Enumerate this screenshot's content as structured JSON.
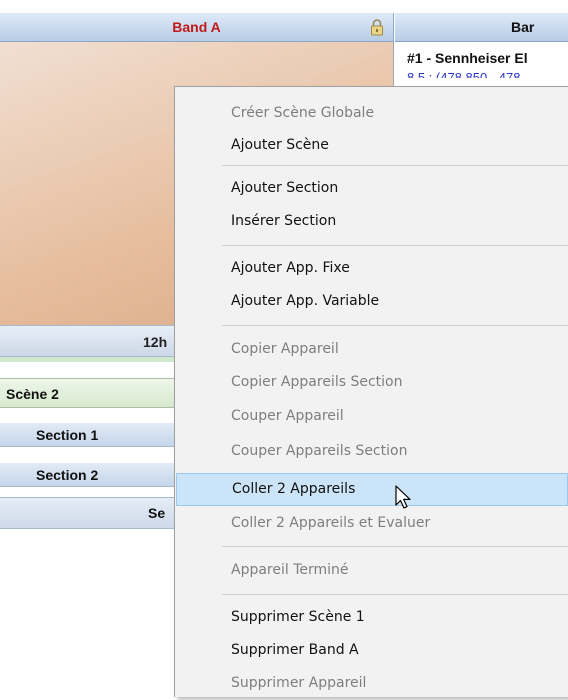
{
  "header": {
    "band_a": "Band A",
    "band_b": "Bar",
    "lock_icon": "lock-icon"
  },
  "band_b": {
    "device": "#1 - Sennheiser El",
    "freq": "8.5 : (478.850 - 478"
  },
  "timeline": {
    "time": "12h"
  },
  "rows": {
    "scene2": "Scène 2",
    "section1": "Section 1",
    "section2": "Section 2",
    "se": "Se"
  },
  "menu": {
    "items": [
      {
        "label": "Créer Scène Globale",
        "enabled": false
      },
      {
        "label": "Ajouter Scène",
        "enabled": true
      },
      {
        "label": "Ajouter Section",
        "enabled": true
      },
      {
        "label": "Insérer Section",
        "enabled": true
      },
      {
        "label": "Ajouter App. Fixe",
        "enabled": true
      },
      {
        "label": "Ajouter App. Variable",
        "enabled": true
      },
      {
        "label": "Copier Appareil",
        "enabled": false
      },
      {
        "label": "Copier Appareils Section",
        "enabled": false
      },
      {
        "label": "Couper Appareil",
        "enabled": false
      },
      {
        "label": "Couper Appareils Section",
        "enabled": false
      },
      {
        "label": "Coller 2 Appareils",
        "enabled": true,
        "highlighted": true
      },
      {
        "label": "Coller 2 Appareils et Evaluer",
        "enabled": false
      },
      {
        "label": "Appareil Terminé",
        "enabled": false
      },
      {
        "label": "Supprimer  Scène 1",
        "enabled": true
      },
      {
        "label": "Supprimer  Band A",
        "enabled": true
      },
      {
        "label": "Supprimer Appareil",
        "enabled": false
      }
    ]
  },
  "colors": {
    "band_a_text": "#c21a1a",
    "highlight": "#cce4f7",
    "highlight_border": "#99c9ef",
    "menu_bg": "#f2f2f2"
  }
}
